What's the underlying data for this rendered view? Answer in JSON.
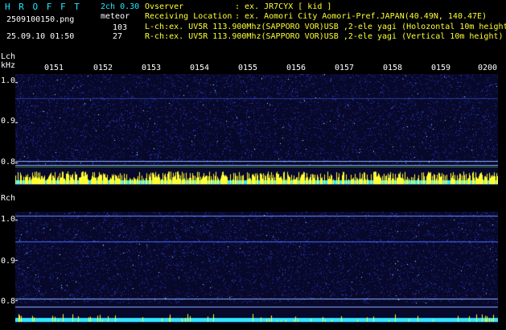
{
  "header": {
    "app_title": "H R O F F T",
    "app_version": "2ch 0.30",
    "filename": "2509100150.png",
    "meteor_label": "meteor",
    "l_count": "103",
    "r_count": "27",
    "datetime": "25.09.10 01:50"
  },
  "info": {
    "observer_label": "Ovserver",
    "observer_value": ": ex. JR7CYX [ kid ]",
    "location_label": "Receiving Location",
    "location_value": ": ex. Aomori City Aomori-Pref.JAPAN(40.49N, 140.47E)",
    "lch_line": "L-ch:ex. UV5R 113.900Mhz(SAPPORO VOR)USB ,2-ele yagi (Holozontal 10m height)",
    "rch_line": "R-ch:ex. UV5R 113.900Mhz(SAPPORO VOR)USB ,2-ele yagi (Vertical 10m height)"
  },
  "lch": {
    "label": "Lch",
    "unit": "kHz",
    "time_ticks": [
      "0151",
      "0152",
      "0153",
      "0154",
      "0155",
      "0156",
      "0157",
      "0158",
      "0159",
      "0200"
    ],
    "freq_ticks": [
      "1.0",
      "0.9",
      "0.8"
    ]
  },
  "rch": {
    "label": "Rch",
    "freq_ticks": [
      "1.0",
      "0.9",
      "0.8"
    ]
  },
  "colors": {
    "background": "#000000",
    "spectrogram_bg": "#08082a",
    "header_cyan": "#22e6ff",
    "activity_yellow": "#ffff33",
    "activity_cyan": "#33e6ff"
  }
}
